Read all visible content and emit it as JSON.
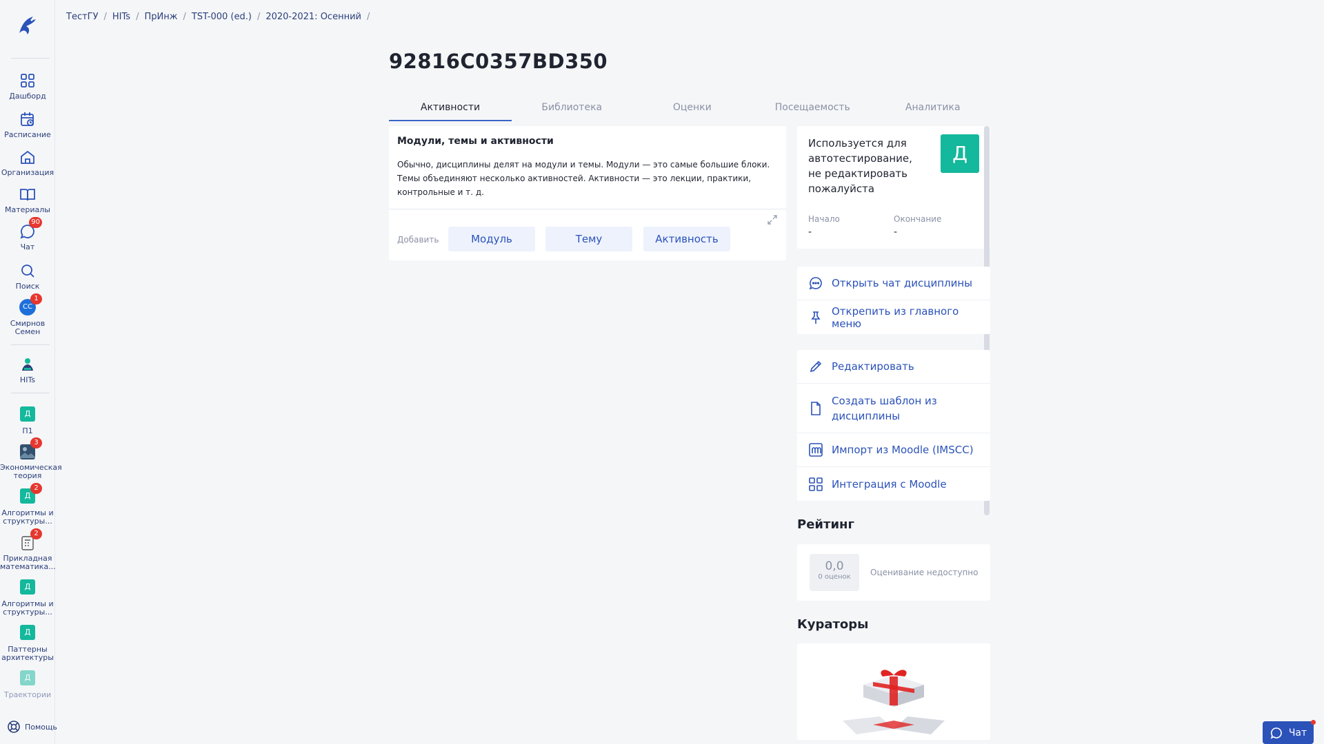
{
  "breadcrumbs": [
    "ТестГУ",
    "HITs",
    "ПрИнж",
    "TST-000 (ed.)",
    "2020-2021: Осенний"
  ],
  "sidebar": {
    "items": [
      {
        "label": "Дашборд"
      },
      {
        "label": "Расписание"
      },
      {
        "label": "Организация"
      },
      {
        "label": "Материалы"
      },
      {
        "label": "Чат",
        "badge": "90"
      },
      {
        "label": "Поиск"
      },
      {
        "label": "Смирнов Семен",
        "avatar": "СС",
        "badge": "1"
      },
      {
        "label": "HITs"
      }
    ],
    "courses": [
      {
        "label": "П1",
        "letter": "Д"
      },
      {
        "label": "Экономическая теория",
        "badge": "3"
      },
      {
        "label": "Алгоритмы и структуры...",
        "letter": "Д",
        "badge": "2"
      },
      {
        "label": "Прикладная математика...",
        "badge": "2"
      },
      {
        "label": "Алгоритмы и структуры...",
        "letter": "Д"
      },
      {
        "label": "Паттерны архитектуры",
        "letter": "Д"
      },
      {
        "label": "Траектории",
        "letter": "Д"
      }
    ],
    "help_label": "Помощь"
  },
  "page_title": "92816C0357BD350",
  "tabs": [
    "Активности",
    "Библиотека",
    "Оценки",
    "Посещаемость",
    "Аналитика"
  ],
  "modules_card": {
    "title": "Модули, темы и активности",
    "description": "Обычно, дисциплины делят на модули и темы. Модули — это самые большие блоки. Темы объединяют несколько активностей. Активности — это лекции, практики, контрольные и т. д.",
    "add_label": "Добавить",
    "buttons": [
      "Модуль",
      "Тему",
      "Активность"
    ]
  },
  "info_card": {
    "text": "Используется для автотестирование, не редактировать пожалуйста",
    "letter": "Д",
    "start_label": "Начало",
    "start_value": "-",
    "end_label": "Окончание",
    "end_value": "-"
  },
  "menu1": [
    "Открыть чат дисциплины",
    "Открепить из главного меню"
  ],
  "menu2": [
    "Редактировать",
    "Создать шаблон из дисциплины",
    "Импорт из Moodle (IMSCC)",
    "Интеграция с Moodle"
  ],
  "rating": {
    "title": "Рейтинг",
    "value": "0,0",
    "count": "0 оценок",
    "status": "Оценивание недоступно"
  },
  "curators_title": "Кураторы",
  "chat_button": "Чат",
  "colors": {
    "accent": "#2b52b9",
    "course_badge": "#14b89c",
    "notification": "#e6372e"
  }
}
